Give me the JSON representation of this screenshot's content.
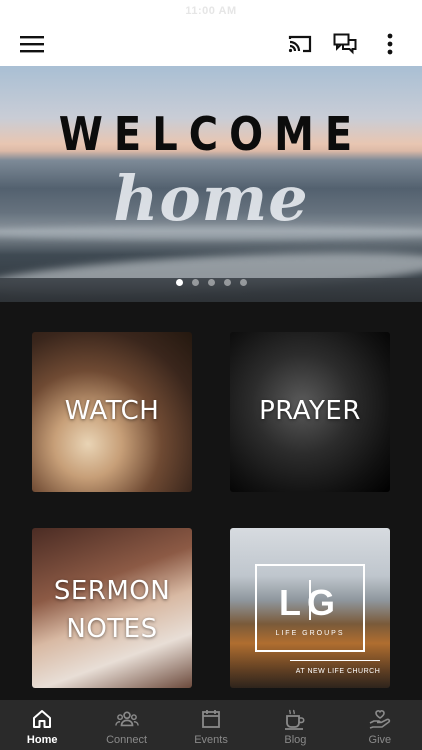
{
  "status_bar": {
    "time": "11:00 AM"
  },
  "app_bar": {
    "menu_icon": "hamburger-menu-icon",
    "cast_icon": "cast-icon",
    "chat_icon": "chat-bubbles-icon",
    "more_icon": "more-vertical-icon"
  },
  "hero": {
    "title": "WELCOME",
    "script": "home",
    "slides": 5,
    "active_slide": 1
  },
  "tiles": [
    {
      "label": "WATCH"
    },
    {
      "label": "PRAYER"
    },
    {
      "label_line1": "SERMON",
      "label_line2": "NOTES"
    },
    {
      "logo_letters": "LG",
      "logo_sub": "LIFE GROUPS",
      "logo_footer": "AT NEW LIFE CHURCH"
    }
  ],
  "bottom_nav": [
    {
      "label": "Home",
      "icon": "home-icon",
      "active": true
    },
    {
      "label": "Connect",
      "icon": "people-icon",
      "active": false
    },
    {
      "label": "Events",
      "icon": "calendar-icon",
      "active": false
    },
    {
      "label": "Blog",
      "icon": "coffee-cup-icon",
      "active": false
    },
    {
      "label": "Give",
      "icon": "giving-hand-icon",
      "active": false
    }
  ]
}
